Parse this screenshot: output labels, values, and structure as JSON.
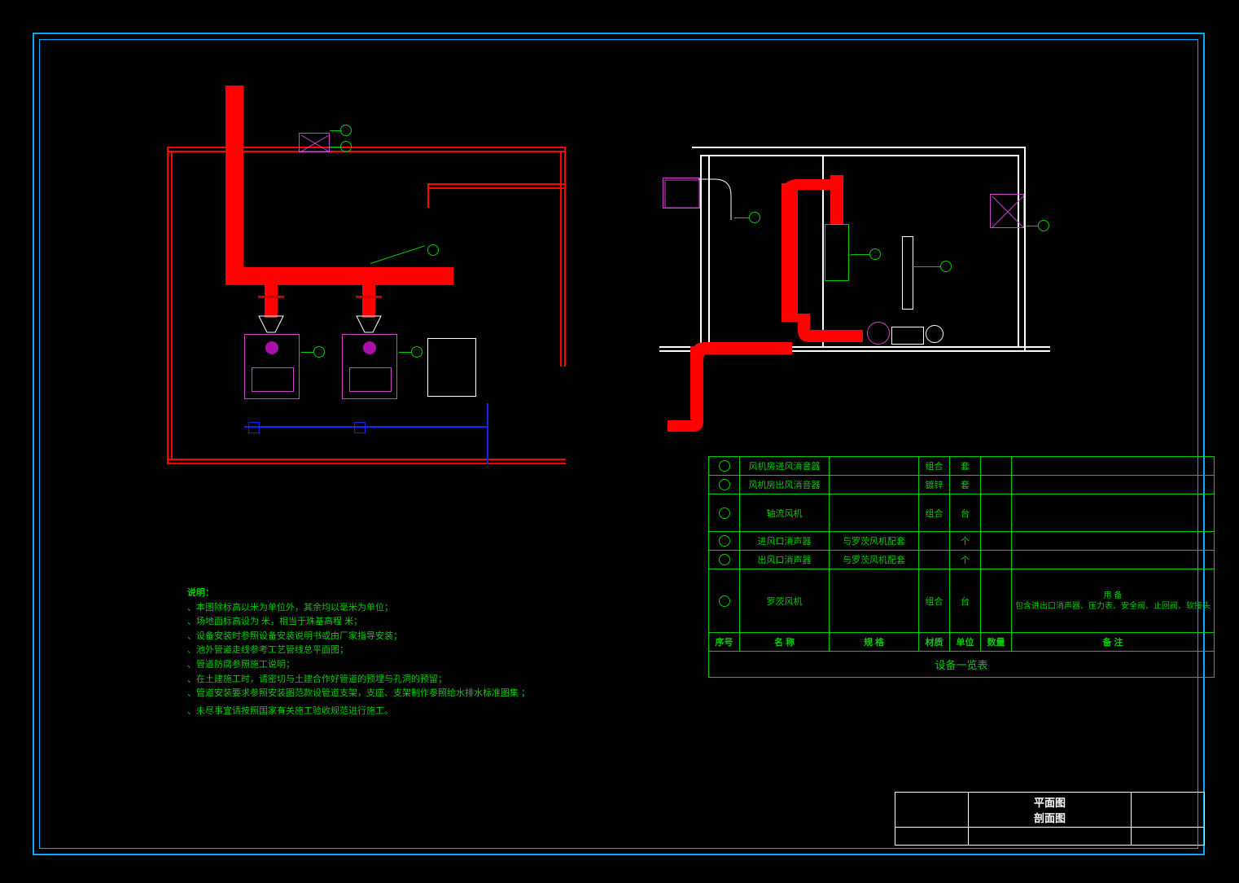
{
  "notes": {
    "heading": "说明：",
    "lines": [
      "、本图除标高以米为单位外，其余均以毫米为单位；",
      "、场地面标高设为            米，相当于珠基高程         米；",
      "、设备安装时参照设备安装说明书或由厂家指导安装；",
      "、池外管道走线参考工艺管线总平面图；",
      "、管道防腐参照施工说明；",
      "、在土建施工时，请密切与土建合作好管道的预埋与孔洞的预留；",
      "、管道安装要求参照安装图范款设管道支架，支座、支架制作参照给水排水标准图集           ；",
      "、未尽事宜请按照国家有关施工验收规范进行施工。"
    ]
  },
  "equipment_table": {
    "title": "设备一览表",
    "headers": [
      "序号",
      "名 称",
      "规 格",
      "材质",
      "单位",
      "数量",
      "备 注"
    ],
    "rows": [
      {
        "no": "",
        "name": "风机房进风消音器",
        "spec": "",
        "mat": "组合",
        "unit": "套",
        "qty": "",
        "note": ""
      },
      {
        "no": "",
        "name": "风机房出风消音器",
        "spec": "",
        "mat": "镀锌",
        "unit": "套",
        "qty": "",
        "note": ""
      },
      {
        "no": "",
        "name": "轴流风机",
        "spec": "",
        "mat": "组合",
        "unit": "台",
        "qty": "",
        "note": ""
      },
      {
        "no": "",
        "name": "进风口消声器",
        "spec": "与罗茨风机配套",
        "mat": "",
        "unit": "个",
        "qty": "",
        "note": ""
      },
      {
        "no": "",
        "name": "出风口消声器",
        "spec": "与罗茨风机配套",
        "mat": "",
        "unit": "个",
        "qty": "",
        "note": ""
      },
      {
        "no": "",
        "name": "罗茨风机",
        "spec": "",
        "mat": "组合",
        "unit": "台",
        "qty": "",
        "note": "用 备\n包含进出口消声器、压力表、安全阀、止回阀、软接头"
      }
    ]
  },
  "title_block": {
    "line1": "平面图",
    "line2": "剖面图"
  },
  "callouts": {
    "plan": [
      "",
      "",
      "",
      "",
      ""
    ],
    "section": [
      "",
      "",
      "",
      ""
    ]
  }
}
